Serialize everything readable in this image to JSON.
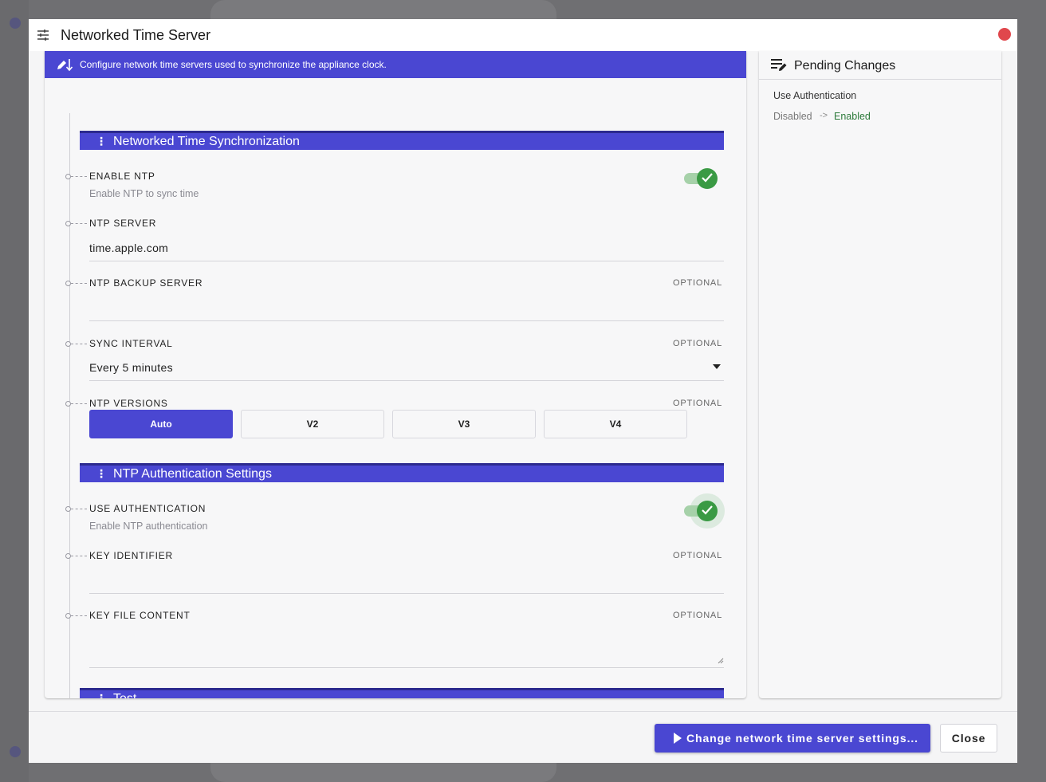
{
  "dialog": {
    "title": "Networked Time Server"
  },
  "banner": {
    "text": "Configure network time servers used to synchronize the appliance clock."
  },
  "sections": {
    "sync": {
      "title": "Networked Time Synchronization"
    },
    "auth": {
      "title": "NTP Authentication Settings"
    },
    "test": {
      "title": "Test"
    }
  },
  "fields": {
    "enable_ntp": {
      "label": "ENABLE NTP",
      "help": "Enable NTP to sync time",
      "enabled": true
    },
    "ntp_server": {
      "label": "NTP SERVER",
      "value": "time.apple.com"
    },
    "ntp_backup_server": {
      "label": "NTP BACKUP SERVER",
      "optional": "OPTIONAL",
      "value": ""
    },
    "sync_interval": {
      "label": "SYNC INTERVAL",
      "optional": "OPTIONAL",
      "value": "Every 5 minutes"
    },
    "ntp_versions": {
      "label": "NTP VERSIONS",
      "optional": "OPTIONAL",
      "options": [
        "Auto",
        "V2",
        "V3",
        "V4"
      ],
      "selected": "Auto"
    },
    "use_authentication": {
      "label": "USE AUTHENTICATION",
      "help": "Enable NTP authentication",
      "enabled": true
    },
    "key_identifier": {
      "label": "KEY IDENTIFIER",
      "optional": "OPTIONAL",
      "value": ""
    },
    "key_file_content": {
      "label": "KEY FILE CONTENT",
      "optional": "OPTIONAL",
      "value": ""
    }
  },
  "pending": {
    "title": "Pending Changes",
    "changes": [
      {
        "name": "Use Authentication",
        "old": "Disabled",
        "arrow": "->",
        "new": "Enabled"
      }
    ]
  },
  "footer": {
    "primary_label": "Change network time server settings...",
    "close_label": "Close"
  },
  "colors": {
    "accent": "#4a47d2",
    "toggle_on": "#3a9a44",
    "close_dot": "#e0474c",
    "change_new": "#2c7a3a"
  },
  "icons": {
    "title": "tune-sliders-icon",
    "banner": "edit-sort-icon",
    "pending": "list-edit-icon",
    "section": "more-vertical-icon",
    "toggle": "check-icon",
    "select": "caret-down-icon",
    "primary": "play-icon"
  }
}
